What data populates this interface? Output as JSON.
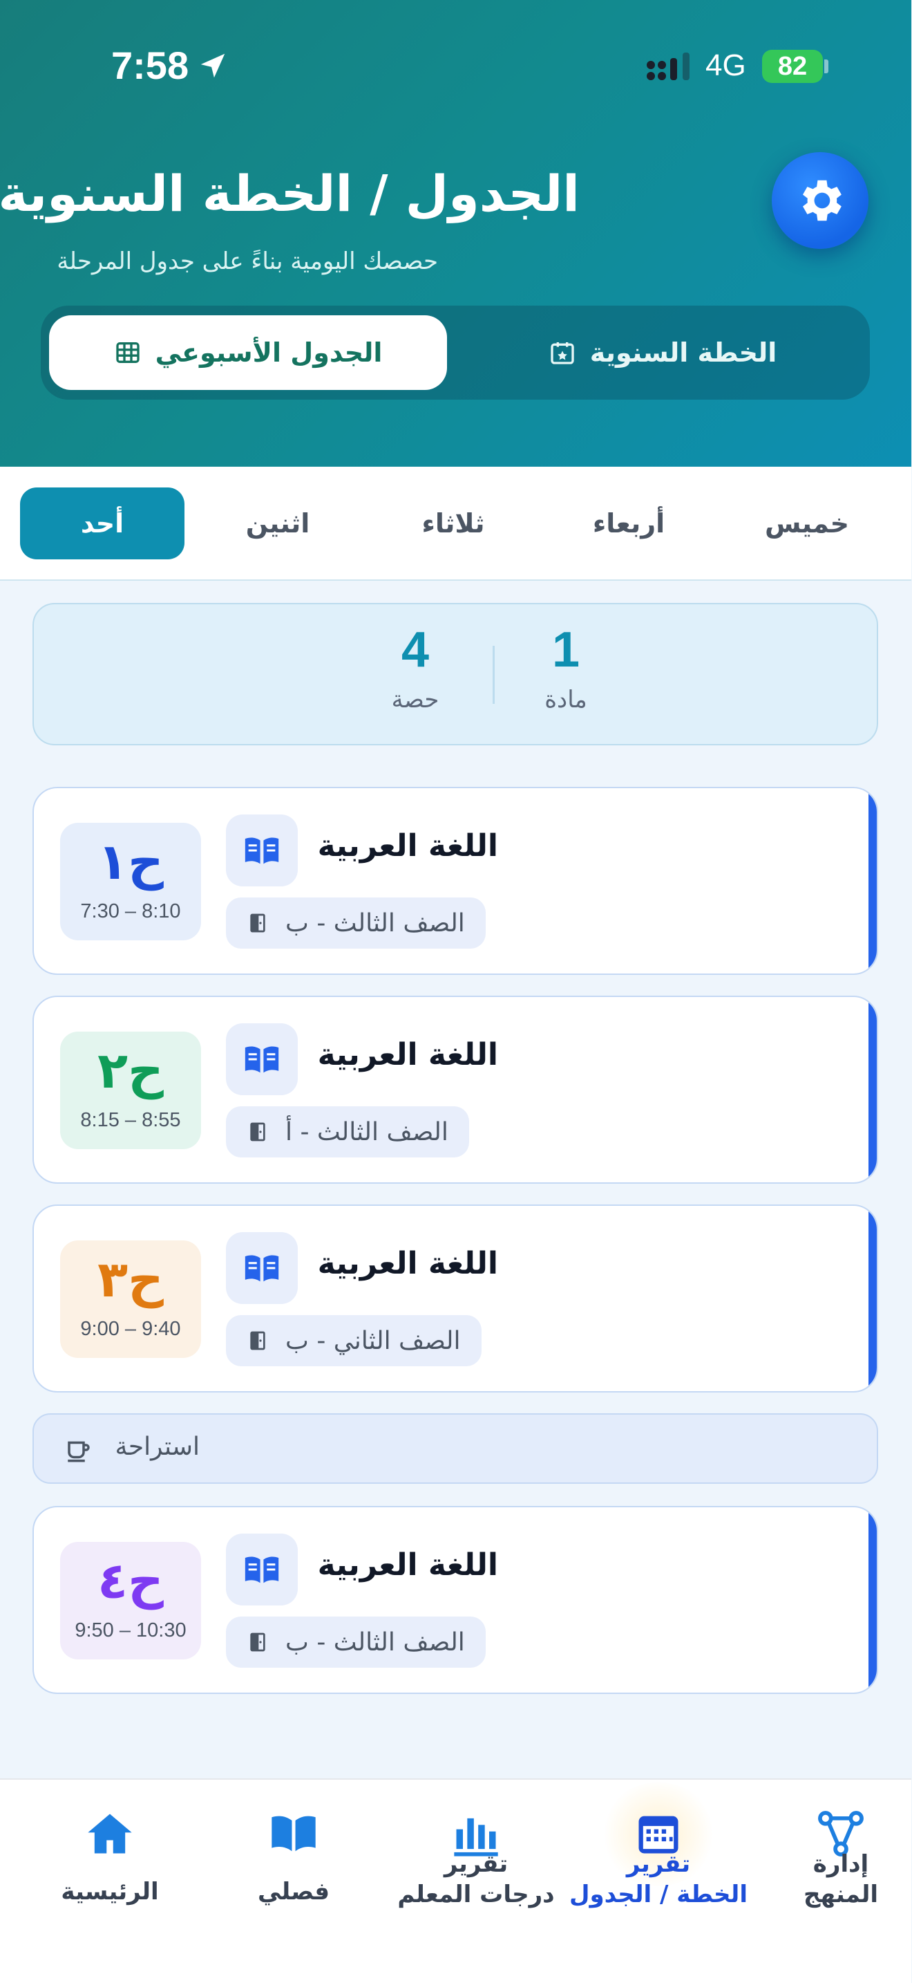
{
  "status_bar": {
    "time": "7:58",
    "network": "4G",
    "battery": "82"
  },
  "header": {
    "title": "الجدول / الخطة السنوية",
    "subtitle": "حصصك اليومية بناءً على جدول المرحلة",
    "tabs": {
      "weekly": "الجدول الأسبوعي",
      "annual": "الخطة السنوية"
    }
  },
  "days": [
    "أحد",
    "اثنين",
    "ثلاثاء",
    "أربعاء",
    "خميس"
  ],
  "active_day": "أحد",
  "summary": {
    "periods_count": "4",
    "periods_label": "حصة",
    "subjects_count": "1",
    "subjects_label": "مادة"
  },
  "lessons": [
    {
      "period": "ح١",
      "time": "7:30 – 8:10",
      "subject": "اللغة العربية",
      "class": "الصف الثالث - ب",
      "color": "#1d4ed8",
      "bg": "#e6eefb"
    },
    {
      "period": "ح٢",
      "time": "8:15 – 8:55",
      "subject": "اللغة العربية",
      "class": "الصف الثالث - أ",
      "color": "#0f9d58",
      "bg": "#e3f5ee"
    },
    {
      "period": "ح٣",
      "time": "9:00 – 9:40",
      "subject": "اللغة العربية",
      "class": "الصف الثاني - ب",
      "color": "#e07a10",
      "bg": "#fcf1e4"
    },
    {
      "period": "ح٤",
      "time": "9:50 – 10:30",
      "subject": "اللغة العربية",
      "class": "الصف الثالث - ب",
      "color": "#7e3af2",
      "bg": "#f2ecfb"
    }
  ],
  "break_label": "استراحة",
  "nav": [
    {
      "label_1": "الرئيسية",
      "label_2": "",
      "icon": "home-icon"
    },
    {
      "label_1": "فصلي",
      "label_2": "",
      "icon": "book-open-icon"
    },
    {
      "label_1": "تقرير",
      "label_2": "درجات المعلم",
      "icon": "bar-chart-icon"
    },
    {
      "label_1": "تقرير",
      "label_2": "الخطة / الجدول",
      "icon": "calendar-grid-icon"
    },
    {
      "label_1": "إدارة",
      "label_2": "المنهج",
      "icon": "hierarchy-icon"
    }
  ],
  "colors": {
    "accent": "#0e8fb0",
    "primary_blue": "#1d4ed8",
    "header_start": "#177d7b",
    "header_end": "#0d8fb3"
  }
}
